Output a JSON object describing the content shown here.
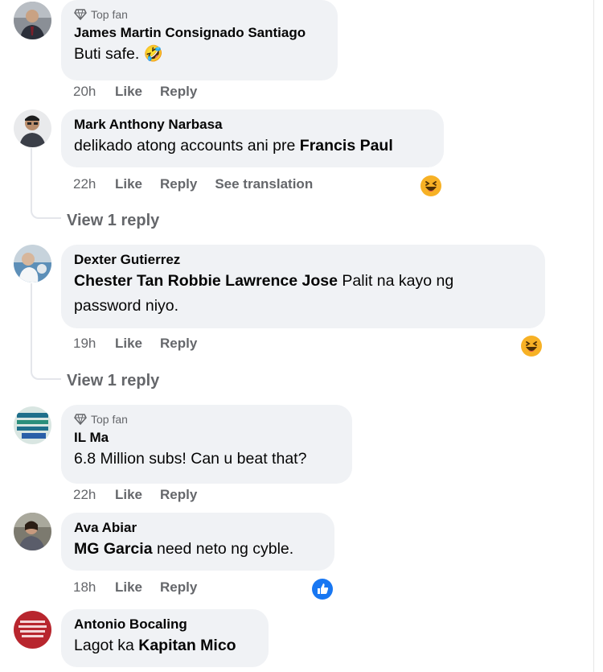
{
  "colors": {
    "bubble": "#f0f2f5",
    "secondary_text": "#65676b",
    "primary_text": "#050505",
    "like_blue": "#1877f2",
    "haha_yellow": "#f7b125"
  },
  "comments": [
    {
      "badge": "Top fan",
      "author": "James Martin Consignado Santiago",
      "text": "Buti safe.",
      "time": "20h",
      "like": "Like",
      "reply": "Reply"
    },
    {
      "author": "Mark Anthony Narbasa",
      "text": "delikado atong accounts ani pre",
      "mention": "Francis Paul",
      "time": "22h",
      "like": "Like",
      "reply": "Reply",
      "translate": "See translation",
      "reaction": "haha-icon",
      "view_replies": "View 1 reply"
    },
    {
      "author": "Dexter Gutierrez",
      "mention": "Chester Tan Robbie Lawrence Jose",
      "text": "Palit na kayo ng",
      "text_line2": "password niyo.",
      "time": "19h",
      "like": "Like",
      "reply": "Reply",
      "reaction": "haha-icon",
      "view_replies": "View 1 reply"
    },
    {
      "badge": "Top fan",
      "author": "IL Ma",
      "text": "6.8 Million subs! Can u beat that?",
      "time": "22h",
      "like": "Like",
      "reply": "Reply"
    },
    {
      "author": "Ava Abiar",
      "mention": "MG Garcia",
      "text": "need neto ng cyble.",
      "time": "18h",
      "like": "Like",
      "reply": "Reply",
      "reaction": "like-icon"
    },
    {
      "author": "Antonio Bocaling",
      "text": "Lagot ka",
      "mention": "Kapitan Mico"
    }
  ]
}
